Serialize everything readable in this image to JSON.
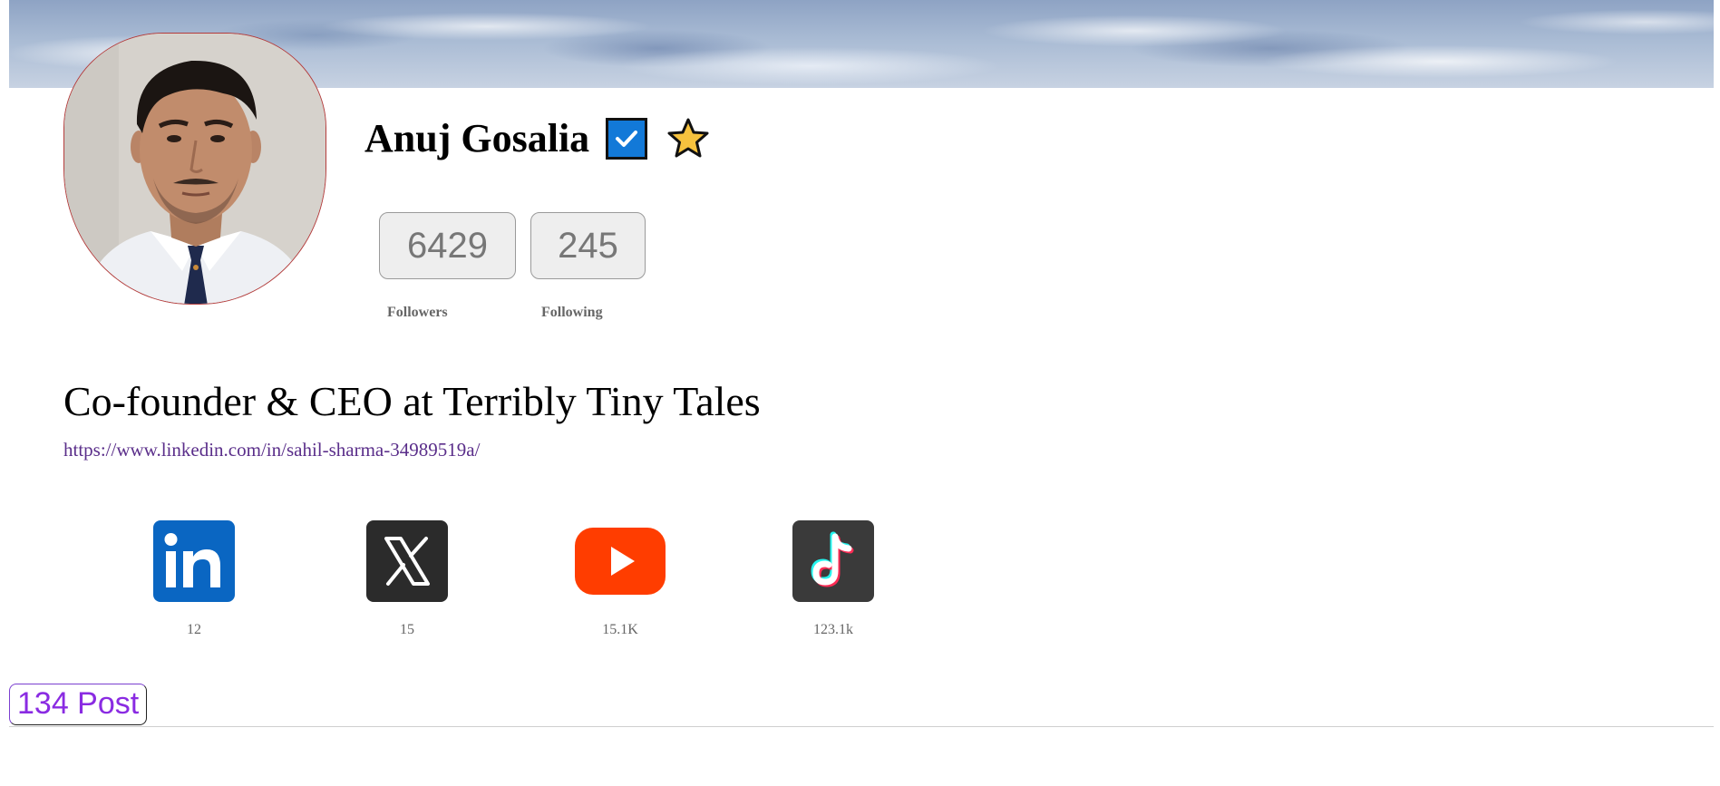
{
  "profile": {
    "name": "Anuj Gosalia",
    "verified_icon": "verified-check-icon",
    "star_icon": "star-icon",
    "headline": "Co-founder & CEO at Terribly Tiny Tales",
    "link": "https://www.linkedin.com/in/sahil-sharma-34989519a/"
  },
  "stats": {
    "followers_count": "6429",
    "followers_label": "Followers",
    "following_count": "245",
    "following_label": "Following"
  },
  "socials": [
    {
      "platform": "linkedin",
      "icon": "linkedin-icon",
      "count": "12"
    },
    {
      "platform": "x",
      "icon": "x-icon",
      "count": "15"
    },
    {
      "platform": "youtube",
      "icon": "youtube-icon",
      "count": "15.1K"
    },
    {
      "platform": "tiktok",
      "icon": "tiktok-icon",
      "count": "123.1k"
    }
  ],
  "posts": {
    "tab_label": "134 Post"
  },
  "colors": {
    "verified_blue": "#1279d8",
    "star_gold": "#f6c23e",
    "link_purple": "#5a2e8a",
    "posts_purple": "#8a2be2",
    "avatar_border": "#b43c3c"
  }
}
